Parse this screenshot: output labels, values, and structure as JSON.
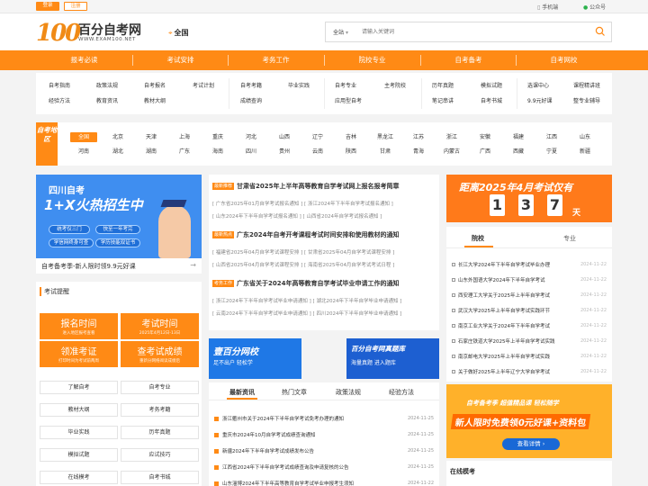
{
  "topbar": {
    "login": "登录",
    "register": "注册",
    "phone": "手机端",
    "wechat": "公众号"
  },
  "header": {
    "logo_num": "100",
    "logo_cn": "百分自考网",
    "logo_url": "WWW.EXAM100.NET",
    "location": "全国",
    "search_select": "全站",
    "search_placeholder": "请输入关键词"
  },
  "nav": [
    "报考必读",
    "考试安排",
    "考务工作",
    "院校专业",
    "自考备考",
    "自考网校"
  ],
  "sub_nav": [
    [
      "自考指南",
      "政策法规",
      "自考报名",
      "考试计划"
    ],
    [
      "自考考籍",
      "毕业实践"
    ],
    [
      "自考专业",
      "主考院校"
    ],
    [
      "历年真题",
      "模拟试题"
    ],
    [
      "选课中心",
      "课程精讲班"
    ],
    [
      "经验方法",
      "教育资讯",
      "教材大纲"
    ],
    [
      "成绩查询"
    ],
    [
      "应用型自考"
    ],
    [
      "笔记串讲",
      "自考书城"
    ],
    [
      "9.9元好课",
      "整专业辅导"
    ]
  ],
  "region": {
    "tag": "自考地区",
    "row1": [
      "全国",
      "北京",
      "天津",
      "上海",
      "重庆",
      "河北",
      "山西",
      "辽宁",
      "吉林",
      "黑龙江",
      "江苏",
      "浙江",
      "安徽",
      "福建",
      "江西",
      "山东"
    ],
    "row2": [
      "河南",
      "湖北",
      "湖南",
      "广东",
      "海南",
      "四川",
      "贵州",
      "云南",
      "陕西",
      "甘肃",
      "青海",
      "内蒙古",
      "广西",
      "西藏",
      "宁夏",
      "新疆"
    ]
  },
  "banner": {
    "t1": "四川自考",
    "t2": "1+X火热招生中",
    "chips": [
      "统考仅三门",
      "快至一年考完",
      "学信网终身可查",
      "学历技能双证书"
    ],
    "caption": "自考备考季-新人限时领9.9元好课",
    "arrow": "→"
  },
  "remind": {
    "title": "考试提醒",
    "big": [
      {
        "t": "报名时间",
        "s": "进入地区报考查看"
      },
      {
        "t": "考试时间",
        "s": "2025年4月12日-13日"
      },
      {
        "t": "领准考证",
        "s": "打印时间为考试前两周"
      },
      {
        "t": "查考试成绩",
        "s": "重新分网络阅读成绩后"
      }
    ],
    "links": [
      "了解自考",
      "自考专业",
      "教材大纲",
      "考务考籍",
      "毕业实践",
      "历年真题",
      "模拟试题",
      "应试技巧",
      "在线模考",
      "自考书城"
    ]
  },
  "news": [
    {
      "tag": "最新推荐",
      "title": "甘肃省2025年上半年高等教育自学考试网上报名报考简章",
      "subs": [
        [
          "[ 广东省2025年01月自学考试报名通知 ]",
          "[ 浙江2024年下半年自学考试报名通知 ]"
        ],
        [
          "[ 山东2024年下半年自学考试报名通知 ]",
          "[ 山西省2024年自学考试报名通知 ]"
        ]
      ]
    },
    {
      "tag": "最新热点",
      "title": "广东2024年自考开考课程考试时间安排和使用教材的通知",
      "subs": [
        [
          "[ 福建省2025年04月自学考试课程安排 ]",
          "[ 甘肃省2025年04月自学考试课程安排 ]"
        ],
        [
          "[ 山西省2025年04月自学考试课程安排 ]",
          "[ 海南省2025年04月自学考试考试日程 ]"
        ]
      ]
    },
    {
      "tag": "考务工作",
      "title": "广东省关于2024年高等教育自学考试毕业申请工作的通知",
      "subs": [
        [
          "[ 浙江2024年下半年自学考试毕业申请通知 ]",
          "[ 湖北2024年下半年自学毕业申请通知 ]"
        ],
        [
          "[ 云南2024年下半年自学考试毕业申请通知 ]",
          "[ 四川2024年下半年自学毕业申请通知 ]"
        ]
      ]
    }
  ],
  "promos": [
    {
      "t": "壹百分网校",
      "s": "足不出户 轻松学"
    },
    {
      "t": "百分自考网真题库",
      "s": "海量真题 进入题库"
    }
  ],
  "tabs": {
    "labels": [
      "最新资讯",
      "热门文章",
      "政策法规",
      "经验方法"
    ],
    "items": [
      {
        "t": "浙江衢州市关于2024年下半年自学考试免考办理的通知",
        "d": "2024-11-25"
      },
      {
        "t": "重庆市2024年10月自学考试成绩查询通知",
        "d": "2024-11-25"
      },
      {
        "t": "新疆2024年下半年自学考试成绩发布公告",
        "d": "2024-11-25"
      },
      {
        "t": "江西省2024年下半年自学考试成绩查询及申请复核的公告",
        "d": "2024-11-25"
      },
      {
        "t": "山东淄博2024年下半年高等教育自学考试毕业申报考生须知",
        "d": "2024-11-22"
      }
    ]
  },
  "countdown": {
    "title": "距离2025年4月考试仅有",
    "digits": [
      "1",
      "3",
      "7"
    ],
    "unit": "天"
  },
  "school": {
    "tabs": [
      "院校",
      "专业"
    ],
    "items": [
      {
        "t": "长江大学2024年下半年自学考试毕业办理",
        "d": "2024-11-22"
      },
      {
        "t": "山东外国语大学2024年下半年自学考试",
        "d": "2024-11-22"
      },
      {
        "t": "西安理工大学关于2025年上半年自学考试",
        "d": "2024-11-22"
      },
      {
        "t": "武汉大学2025年上半年自学考试实践环节",
        "d": "2024-11-22"
      },
      {
        "t": "南京工业大学关于2024年下半年自学考试",
        "d": "2024-11-22"
      },
      {
        "t": "石家庄铁道大学2025年上半年自学考试实践",
        "d": "2024-11-22"
      },
      {
        "t": "南京邮电大学2025年上半年自学考试实践",
        "d": "2024-11-22"
      },
      {
        "t": "关于做好2025年上半年辽宁大学自学考试",
        "d": "2024-11-22"
      }
    ]
  },
  "free": {
    "t1": "自考备考季 超值精品课 轻松随学",
    "t2": "新人限时免费领0元好课+资料包",
    "btn": "查看详情 ›"
  },
  "online": {
    "title": "在线模考"
  },
  "colors": {
    "accent": "#ff8a15",
    "blue": "#3f8ef0"
  }
}
